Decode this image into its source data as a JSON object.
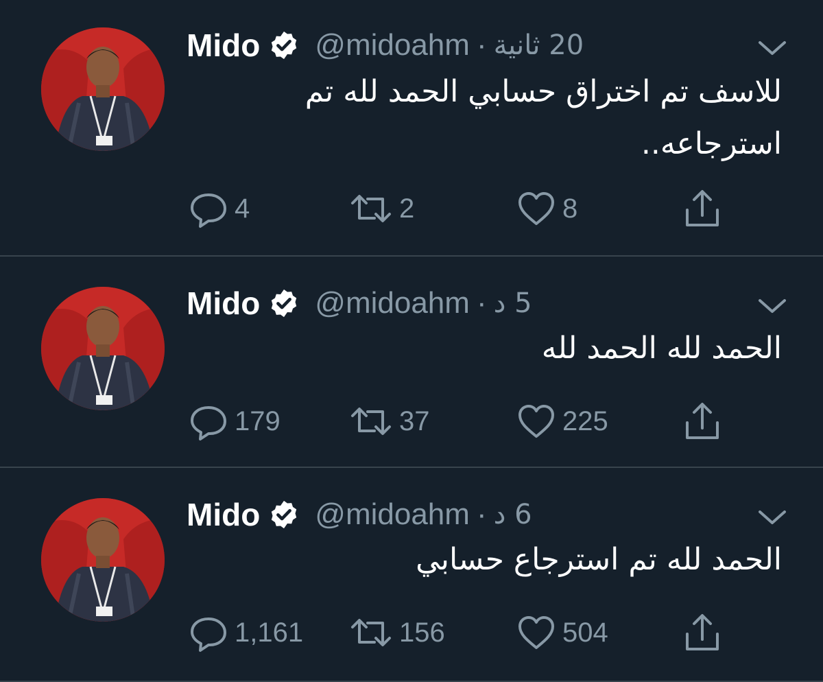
{
  "user": {
    "name": "Mido",
    "handle": "@midoahm",
    "separator": "·"
  },
  "colors": {
    "background": "#15202b",
    "divider": "#38444d",
    "secondary_text": "#8899a6",
    "primary_text": "#ffffff"
  },
  "icons": {
    "verified": "verified-badge-icon",
    "caret": "chevron-down-icon",
    "reply": "reply-icon",
    "retweet": "retweet-icon",
    "like": "heart-icon",
    "share": "share-icon"
  },
  "tweets": [
    {
      "time": "20 ثانية",
      "text_line1": "للاسف تم اختراق حسابي الحمد لله تم",
      "text_line2": "استرجاعه..",
      "replies": "4",
      "retweets": "2",
      "likes": "8"
    },
    {
      "time": "5 د",
      "text_line1": "الحمد لله الحمد لله",
      "text_line2": "",
      "replies": "179",
      "retweets": "37",
      "likes": "225"
    },
    {
      "time": "6 د",
      "text_line1": "الحمد لله تم استرجاع حسابي",
      "text_line2": "",
      "replies": "1,161",
      "retweets": "156",
      "likes": "504"
    }
  ]
}
